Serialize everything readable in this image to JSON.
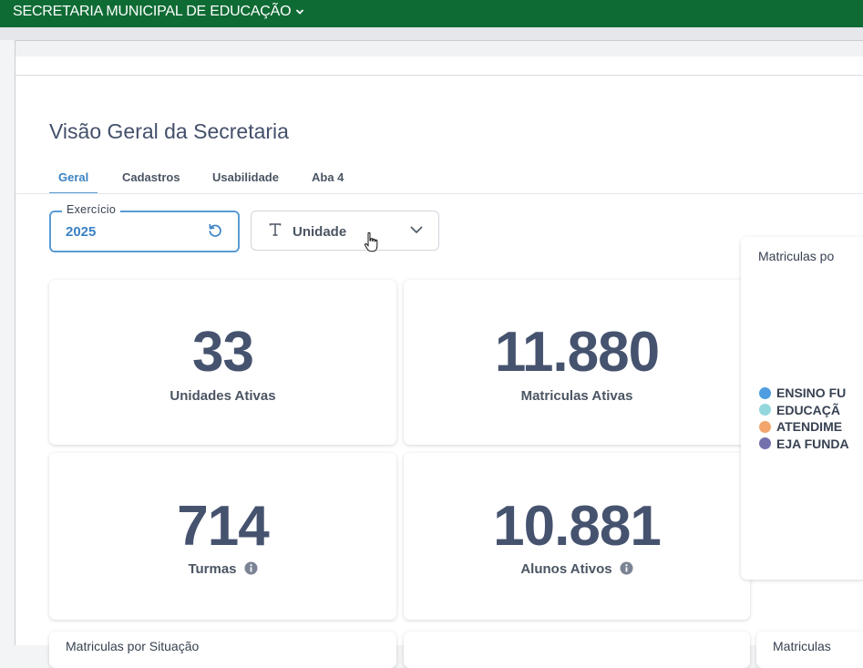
{
  "header": {
    "org_label": "SECRETARIA MUNICIPAL DE EDUCAÇÃO"
  },
  "page": {
    "title": "Visão Geral da Secretaria"
  },
  "tabs": [
    {
      "label": "Geral"
    },
    {
      "label": "Cadastros"
    },
    {
      "label": "Usabilidade"
    },
    {
      "label": "Aba 4"
    }
  ],
  "filters": {
    "year": {
      "legend": "Exercício",
      "value": "2025"
    },
    "unit": {
      "placeholder": "Unidade"
    }
  },
  "kpis": [
    {
      "value": "33",
      "label": "Unidades Ativas"
    },
    {
      "value": "11.880",
      "label": "Matriculas Ativas"
    },
    {
      "value": "714",
      "label": "Turmas"
    },
    {
      "value": "10.881",
      "label": "Alunos Ativos"
    }
  ],
  "pie_panel": {
    "title": "Matriculas po",
    "legend": [
      {
        "label": "ENSINO FU",
        "color": "#4e9de0"
      },
      {
        "label": "EDUCAÇÃ",
        "color": "#93d8dc"
      },
      {
        "label": "ATENDIME",
        "color": "#f3a56b"
      },
      {
        "label": "EJA FUNDA",
        "color": "#7370ae"
      }
    ]
  },
  "bottom_cards": [
    {
      "title": "Matriculas por Situação"
    },
    {
      "title": "Matriculas"
    }
  ],
  "colors": {
    "brand": "#0f6b34",
    "accent": "#3b82c4",
    "kpi_text": "#46536f"
  }
}
